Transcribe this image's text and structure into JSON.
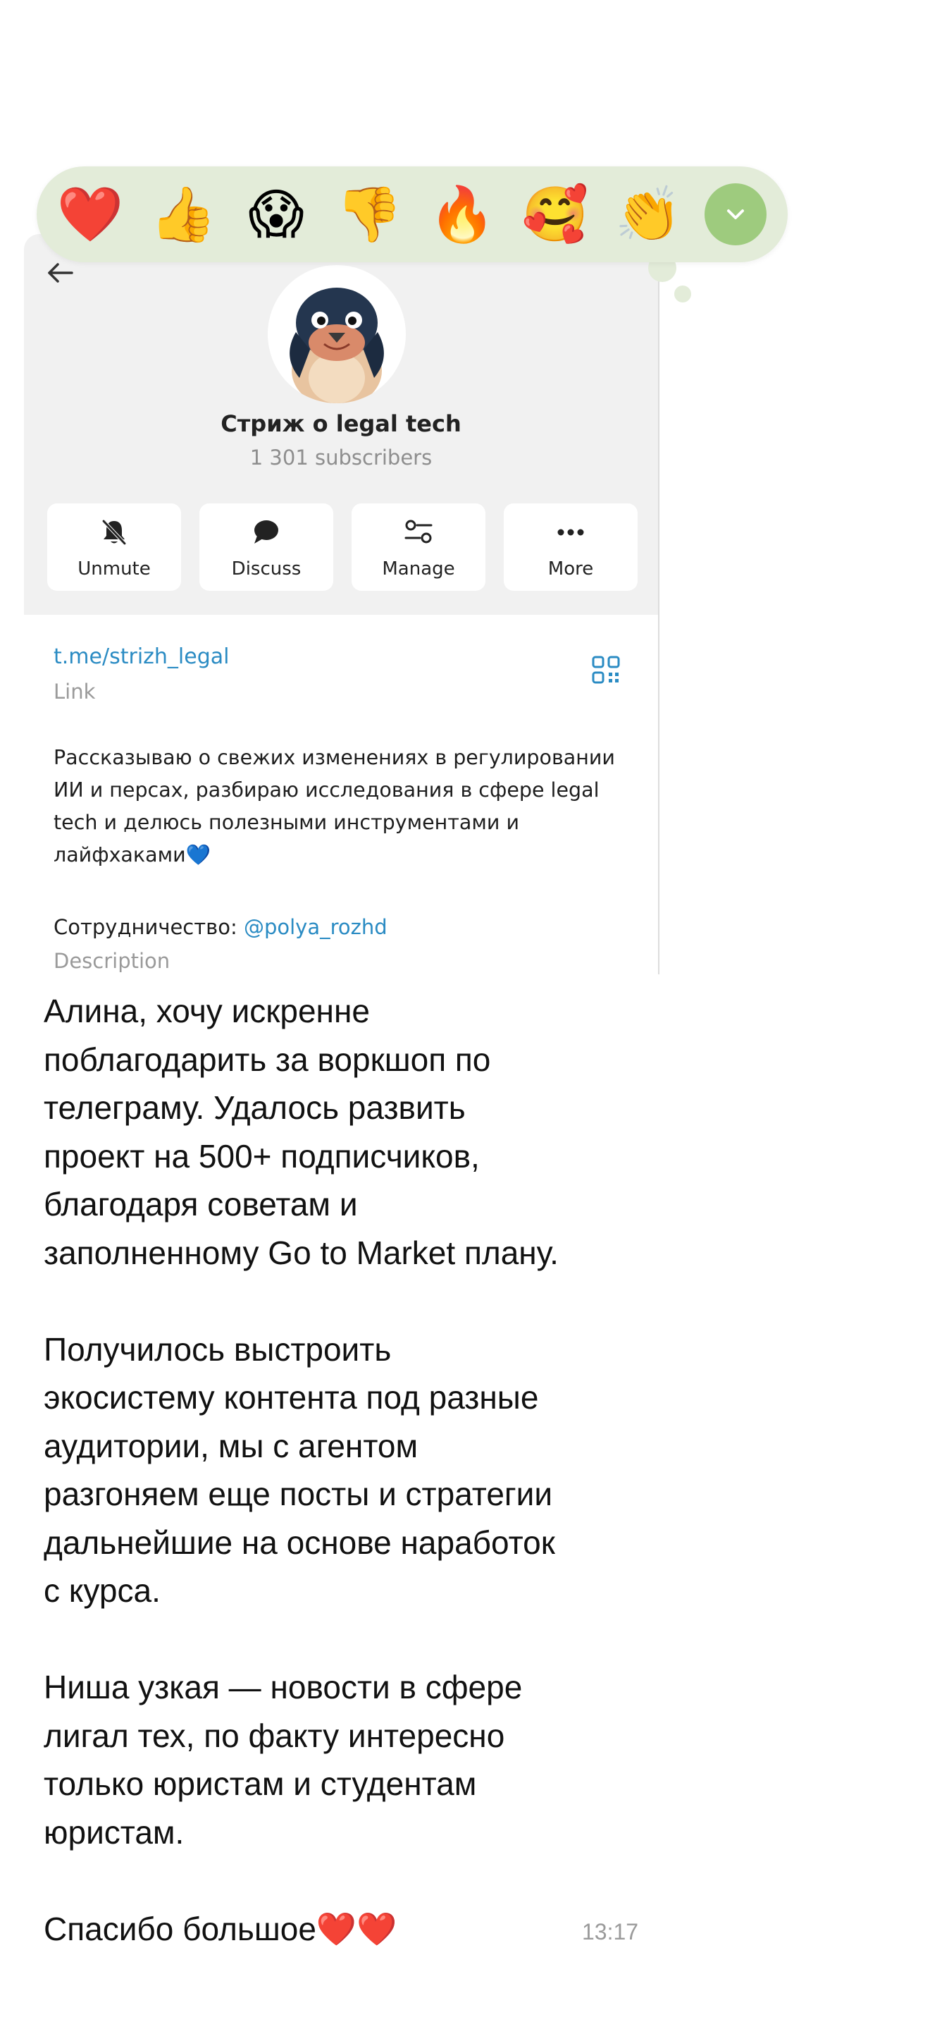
{
  "reactions": [
    {
      "emoji": "❤️",
      "name": "heart"
    },
    {
      "emoji": "👍",
      "name": "thumbs-up"
    },
    {
      "emoji": "😱",
      "name": "screaming"
    },
    {
      "emoji": "👎",
      "name": "thumbs-down"
    },
    {
      "emoji": "🔥",
      "name": "fire"
    },
    {
      "emoji": "🥰",
      "name": "smiling-hearts"
    },
    {
      "emoji": "👏",
      "name": "clapping"
    }
  ],
  "reaction_bar": {
    "background": "#e3ecd9",
    "expand_color": "#9ecb7e",
    "expand_icon": "chevron-down-icon"
  },
  "profile": {
    "name": "Стриж о legal tech",
    "subscribers": "1 301 subscribers",
    "actions": [
      {
        "label": "Unmute",
        "icon": "bell-off-icon"
      },
      {
        "label": "Discuss",
        "icon": "chat-bubble-icon"
      },
      {
        "label": "Manage",
        "icon": "sliders-icon"
      },
      {
        "label": "More",
        "icon": "more-dots-icon"
      }
    ],
    "link": "t.me/strizh_legal",
    "link_caption": "Link",
    "description_lines": [
      "Рассказываю о свежих изменениях в регулировании",
      "ИИ и персах, разбираю исследования в сфере legal",
      "tech и делюсь полезными инструментами и",
      "лайфхаками💙"
    ],
    "coop_label": "Сотрудничество: ",
    "coop_handle": "@polya_rozhd",
    "description_caption": "Description"
  },
  "message": {
    "lines": [
      "Алина, хочу искренне",
      "поблагодарить за воркшоп по",
      "телеграму. Удалось развить",
      "проект на 500+ подписчиков,",
      "благодаря советам и",
      "заполненному Go to Market плану.",
      "",
      "Получилось выстроить",
      "экосистему контента под разные",
      "аудитории, мы с агентом",
      "разгоняем еще посты и стратегии",
      "дальнейшие на основе наработок",
      "с курса.",
      "",
      "Ниша узкая — новости в сфере",
      "лигал тех, по факту интересно",
      "только юристам и студентам",
      "юристам.",
      "",
      "Спасибо большое❤️❤️"
    ],
    "time": "13:17"
  },
  "colors": {
    "link": "#2a8bc3",
    "muted": "#9a9a9a",
    "card_head": "#f1f1f1"
  }
}
